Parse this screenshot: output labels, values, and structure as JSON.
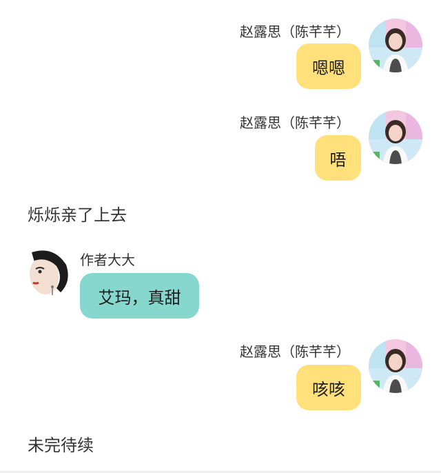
{
  "messages": [
    {
      "type": "right",
      "sender": "赵露思（陈芊芊）",
      "text": "嗯嗯"
    },
    {
      "type": "right",
      "sender": "赵露思（陈芊芊）",
      "text": "唔"
    },
    {
      "type": "narration",
      "text": "烁烁亲了上去"
    },
    {
      "type": "left",
      "sender": "作者大大",
      "text": "艾玛，真甜"
    },
    {
      "type": "right",
      "sender": "赵露思（陈芊芊）",
      "text": "咳咳"
    },
    {
      "type": "narration",
      "text": "未完待续"
    }
  ],
  "colors": {
    "right_bubble": "#ffe07a",
    "left_bubble": "#86d8cf"
  },
  "icons": {
    "right_avatar": "avatar-zhao-lusi",
    "left_avatar": "avatar-author"
  }
}
